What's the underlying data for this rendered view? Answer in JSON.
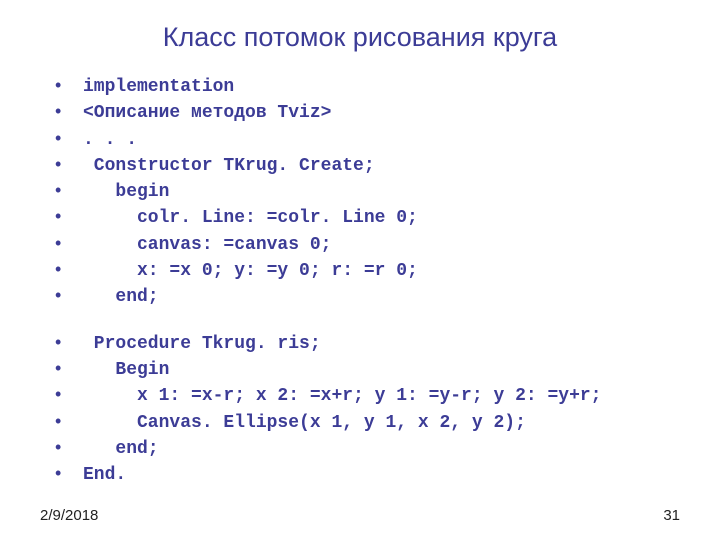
{
  "title": "Класс потомок рисования круга",
  "block1": [
    "implementation",
    "<Описание методов Tviz>",
    ". . .",
    " Constructor TKrug. Create;",
    "   begin",
    "     colr. Line: =colr. Line 0;",
    "     canvas: =canvas 0;",
    "     x: =x 0; y: =y 0; r: =r 0;",
    "   end;"
  ],
  "block2": [
    " Procedure Tkrug. ris;",
    "   Begin",
    "     x 1: =x-r; x 2: =x+r; y 1: =y-r; y 2: =y+r;",
    "     Canvas. Ellipse(x 1, y 1, x 2, y 2);",
    "   end;",
    "End."
  ],
  "footer": {
    "date": "2/9/2018",
    "page": "31"
  }
}
